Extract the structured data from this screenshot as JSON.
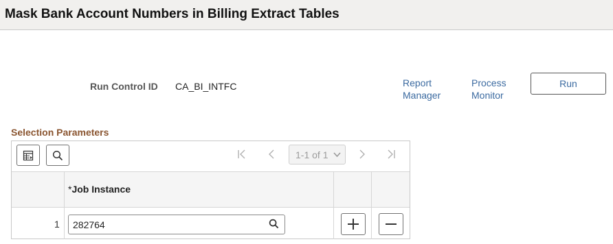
{
  "page": {
    "title": "Mask Bank Account Numbers in Billing Extract Tables"
  },
  "run_control": {
    "label": "Run Control ID",
    "value": "CA_BI_INTFC"
  },
  "links": {
    "report_manager": [
      "Report",
      "Manager"
    ],
    "process_monitor": [
      "Process",
      "Monitor"
    ]
  },
  "run_button": {
    "label": "Run"
  },
  "selection": {
    "title": "Selection Parameters",
    "pager": {
      "text": "1-1 of 1"
    },
    "columns": {
      "required_mark": "*",
      "job_instance": "Job Instance"
    },
    "rows": [
      {
        "row_number": "1",
        "job_instance": "282764"
      }
    ]
  },
  "icons": {
    "view_all": "grid-view-icon",
    "find": "search-icon",
    "first": "first-page-icon",
    "previous": "previous-page-icon",
    "next": "next-page-icon",
    "last": "last-page-icon",
    "prompt": "search-icon",
    "add_row": "plus-icon",
    "delete_row": "minus-icon"
  },
  "colors": {
    "link": "#3b6aa0",
    "section_title": "#8a5530",
    "title_bar": "#f1f0ee"
  }
}
